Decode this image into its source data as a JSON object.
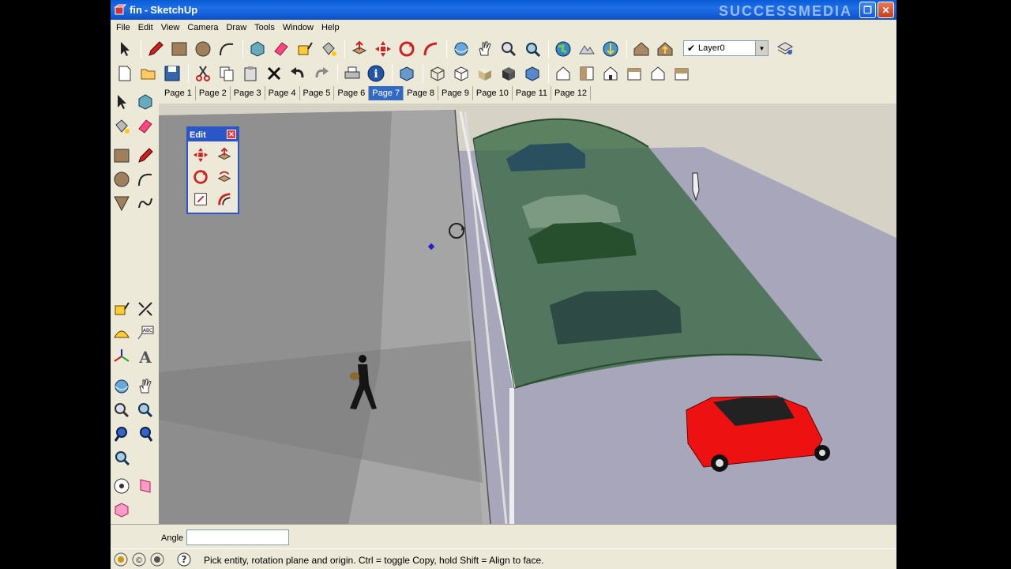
{
  "window": {
    "title": "SketchUp",
    "title_prefix": "- ",
    "watermark": "SUCCESSMEDIA"
  },
  "menu": [
    "File",
    "Edit",
    "View",
    "Camera",
    "Draw",
    "Tools",
    "Window",
    "Help"
  ],
  "layer": {
    "current": "Layer0"
  },
  "pages": [
    "Page 1",
    "Page 2",
    "Page 3",
    "Page 4",
    "Page 5",
    "Page 6",
    "Page 7",
    "Page 8",
    "Page 9",
    "Page 10",
    "Page 11",
    "Page 12"
  ],
  "active_page": "Page 7",
  "edit_toolbar": {
    "title": "Edit"
  },
  "vcb": {
    "label": "Angle",
    "value": ""
  },
  "status": {
    "message": "Pick entity, rotation plane and origin.  Ctrl = toggle Copy, hold Shift = Align to face."
  },
  "colors": {
    "titlebar": "#0a5bd6",
    "active_tab": "#316ac5",
    "red_car": "#ee1111",
    "canopy": "#2e6a3c"
  }
}
